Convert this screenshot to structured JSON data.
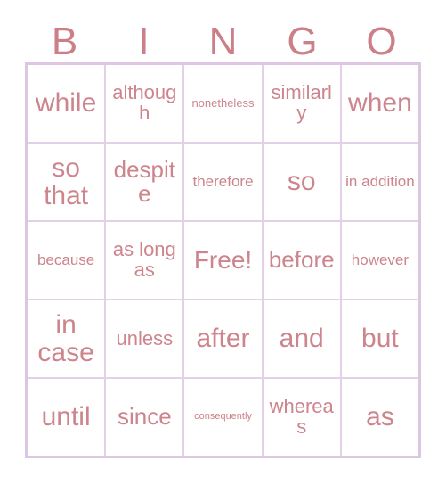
{
  "card": {
    "title": "Bingo Card",
    "header_letters": [
      "B",
      "I",
      "N",
      "G",
      "O"
    ],
    "colors": {
      "header_letter": "#cc7f87",
      "cell_text": "#cd848c",
      "outer_border": "#ddc6e3",
      "inner_border": "#e3d0e8",
      "background": "#ffffff"
    },
    "grid_size": "5x5",
    "free_space": "Free!",
    "rows": [
      {
        "cells": [
          {
            "text": "while",
            "size": "xl"
          },
          {
            "text": "although",
            "size": "md"
          },
          {
            "text": "nonetheless",
            "size": "xs"
          },
          {
            "text": "similarly",
            "size": "md"
          },
          {
            "text": "when",
            "size": "xl"
          }
        ]
      },
      {
        "cells": [
          {
            "text": "so that",
            "size": "xl"
          },
          {
            "text": "despite",
            "size": "lg"
          },
          {
            "text": "therefore",
            "size": "sm"
          },
          {
            "text": "so",
            "size": "xl"
          },
          {
            "text": "in addition",
            "size": "sm"
          }
        ]
      },
      {
        "cells": [
          {
            "text": "because",
            "size": "sm"
          },
          {
            "text": "as long as",
            "size": "md"
          },
          {
            "text": "Free!",
            "size": "free"
          },
          {
            "text": "before",
            "size": "lg"
          },
          {
            "text": "however",
            "size": "sm"
          }
        ]
      },
      {
        "cells": [
          {
            "text": "in case",
            "size": "xl"
          },
          {
            "text": "unless",
            "size": "md"
          },
          {
            "text": "after",
            "size": "xl"
          },
          {
            "text": "and",
            "size": "xl"
          },
          {
            "text": "but",
            "size": "xl"
          }
        ]
      },
      {
        "cells": [
          {
            "text": "until",
            "size": "xl"
          },
          {
            "text": "since",
            "size": "lg"
          },
          {
            "text": "consequently",
            "size": "xxs"
          },
          {
            "text": "whereas",
            "size": "md"
          },
          {
            "text": "as",
            "size": "xl"
          }
        ]
      }
    ]
  }
}
